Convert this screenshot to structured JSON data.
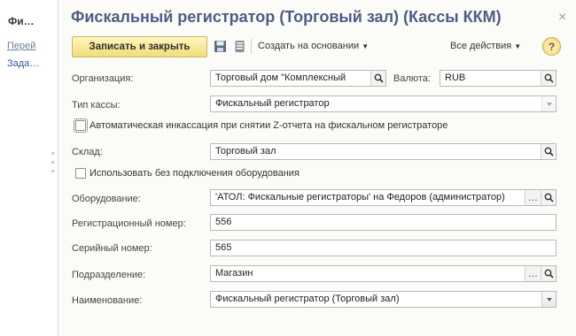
{
  "left_panel": {
    "title": "Фи…",
    "link_go": "Перей",
    "link_tasks": "Зада…"
  },
  "header": {
    "title": "Фискальный регистратор (Торговый зал) (Кассы ККМ)",
    "close": "×"
  },
  "toolbar": {
    "save_close_label": "Записать и закрыть",
    "save_icon": "floppy-disk-icon",
    "doc_icon": "document-list-icon",
    "create_based_label": "Создать на основании",
    "all_actions_label": "Все действия",
    "help_label": "?"
  },
  "form": {
    "organization": {
      "label": "Организация:",
      "value": "Торговый дом \"Комплексный"
    },
    "currency": {
      "label": "Валюта:",
      "value": "RUB"
    },
    "cash_type": {
      "label": "Тип кассы:",
      "value": "Фискальный регистратор"
    },
    "auto_collection": {
      "label": "Автоматическая инкассация при снятии Z-отчета на фискальном регистраторе",
      "checked": false
    },
    "warehouse": {
      "label": "Склад:",
      "value": "Торговый зал"
    },
    "no_equipment": {
      "label": "Использовать без подключения оборудования",
      "checked": false
    },
    "equipment": {
      "label": "Оборудование:",
      "value": "'АТОЛ: Фискальные регистраторы' на Федоров (администратор)"
    },
    "reg_number": {
      "label": "Регистрационный номер:",
      "value": "556"
    },
    "serial_number": {
      "label": "Серийный номер:",
      "value": "565"
    },
    "department": {
      "label": "Подразделение:",
      "value": "Магазин"
    },
    "name": {
      "label": "Наименование:",
      "value": "Фискальный регистратор (Торговый зал)"
    }
  },
  "colors": {
    "title": "#4e5d86",
    "primary_button": "#f1dd78",
    "link": "#2b5a9a"
  }
}
